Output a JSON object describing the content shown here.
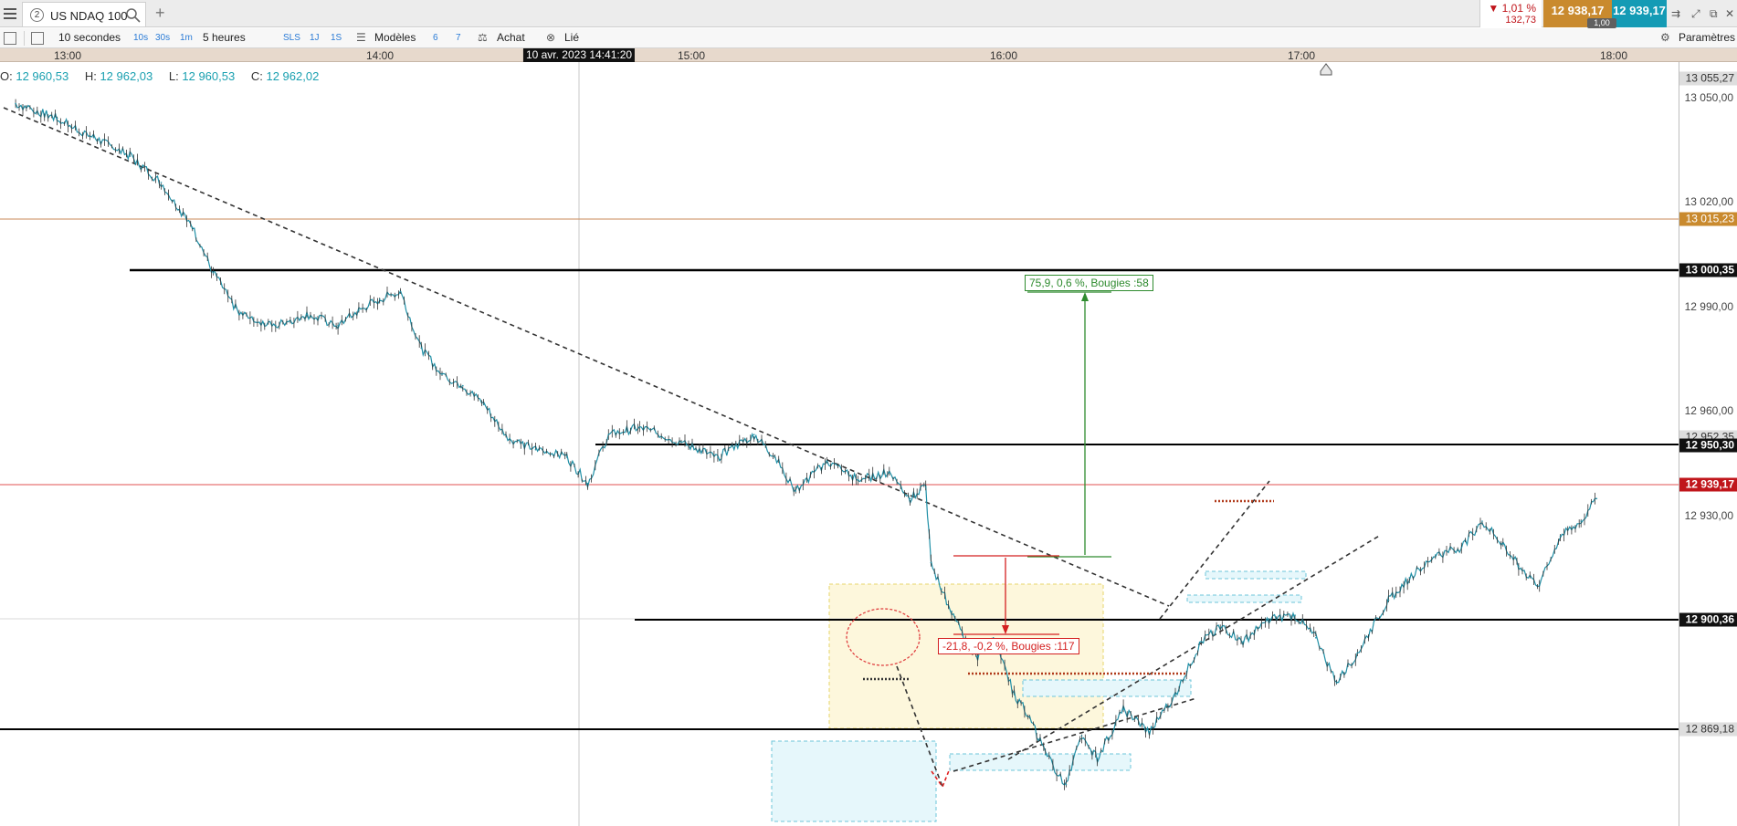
{
  "topbar": {
    "tab_number": "2",
    "tab_title": "US NDAQ 100",
    "change_pct": "▼ 1,01 %",
    "change_abs": "132,73",
    "sell_price": "12 938,17",
    "buy_price": "12 939,17",
    "quantity": "1,00"
  },
  "toolbar": {
    "interval": "10 secondes",
    "interval_shortcuts": [
      "10s",
      "30s",
      "1m"
    ],
    "duration": "5 heures",
    "duration_shortcuts": [
      "SLS",
      "1J",
      "1S"
    ],
    "models_label": "Modèles",
    "models_shortcuts": [
      "6",
      "7"
    ],
    "buy_label": "Achat",
    "linked_label": "Lié",
    "settings_label": "Paramètres"
  },
  "chart_data": {
    "type": "line",
    "title": "US NDAQ 100",
    "x_ticks": [
      "13:00",
      "14:00",
      "15:00",
      "16:00",
      "17:00",
      "18:00"
    ],
    "cursor_time": "10 avr. 2023 14:41:20",
    "ohlc": {
      "open": "12 960,53",
      "high": "12 962,03",
      "low": "12 960,53",
      "close": "12 962,02"
    },
    "y_axis": {
      "ticks": [
        "13 050,00",
        "13 020,00",
        "12 990,00",
        "12 960,00",
        "12 930,00"
      ],
      "range": [
        12855,
        13058
      ],
      "tags": [
        {
          "label": "13 055,27",
          "style": "grey",
          "price": 13055.27
        },
        {
          "label": "13 015,23",
          "style": "orange",
          "price": 13015.23
        },
        {
          "label": "13 000,35",
          "style": "black",
          "price": 13000.35
        },
        {
          "label": "12 952,35",
          "style": "grey",
          "price": 12952.35
        },
        {
          "label": "12 950,30",
          "style": "black",
          "price": 12950.3
        },
        {
          "label": "12 939,17",
          "style": "red",
          "price": 12939.17
        },
        {
          "label": "12 900,36",
          "style": "black",
          "price": 12900.36
        },
        {
          "label": "12 869,18",
          "style": "grey",
          "price": 12869.18
        }
      ]
    },
    "series": [
      {
        "values": [
          [
            "12:50",
            13047
          ],
          [
            "12:58",
            13043
          ],
          [
            "13:05",
            13038
          ],
          [
            "13:12",
            13033
          ],
          [
            "13:18",
            13026
          ],
          [
            "13:24",
            13014
          ],
          [
            "13:28",
            13002
          ],
          [
            "13:33",
            12991
          ],
          [
            "13:40",
            12988
          ],
          [
            "13:46",
            12991
          ],
          [
            "13:52",
            12988
          ],
          [
            "13:56",
            12992
          ],
          [
            "14:00",
            12995
          ],
          [
            "14:04",
            12997
          ],
          [
            "14:08",
            12982
          ],
          [
            "14:12",
            12975
          ],
          [
            "14:16",
            12972
          ],
          [
            "14:20",
            12967
          ],
          [
            "14:25",
            12958
          ],
          [
            "14:30",
            12955
          ],
          [
            "14:36",
            12953
          ],
          [
            "14:40",
            12946
          ],
          [
            "14:44",
            12959
          ],
          [
            "14:50",
            12961
          ],
          [
            "14:58",
            12957
          ],
          [
            "15:05",
            12953
          ],
          [
            "15:12",
            12959
          ],
          [
            "15:16",
            12953
          ],
          [
            "15:20",
            12944
          ],
          [
            "15:26",
            12952
          ],
          [
            "15:32",
            12947
          ],
          [
            "15:38",
            12949
          ],
          [
            "15:42",
            12942
          ],
          [
            "15:45",
            12945
          ],
          [
            "15:46",
            12925
          ],
          [
            "15:48",
            12918
          ],
          [
            "15:50",
            12912
          ],
          [
            "15:52",
            12906
          ],
          [
            "15:55",
            12900
          ],
          [
            "15:58",
            12905
          ],
          [
            "16:02",
            12890
          ],
          [
            "16:05",
            12884
          ],
          [
            "16:08",
            12874
          ],
          [
            "16:12",
            12866
          ],
          [
            "16:15",
            12879
          ],
          [
            "16:18",
            12873
          ],
          [
            "16:23",
            12886
          ],
          [
            "16:28",
            12880
          ],
          [
            "16:33",
            12890
          ],
          [
            "16:38",
            12904
          ],
          [
            "16:42",
            12908
          ],
          [
            "16:46",
            12904
          ],
          [
            "16:51",
            12910
          ],
          [
            "16:56",
            12911
          ],
          [
            "17:00",
            12905
          ],
          [
            "17:04",
            12893
          ],
          [
            "17:08",
            12901
          ],
          [
            "17:14",
            12915
          ],
          [
            "17:18",
            12921
          ],
          [
            "17:23",
            12927
          ],
          [
            "17:28",
            12929
          ],
          [
            "17:32",
            12936
          ],
          [
            "17:36",
            12930
          ],
          [
            "17:39",
            12924
          ],
          [
            "17:43",
            12919
          ],
          [
            "17:47",
            12932
          ],
          [
            "17:51",
            12936
          ],
          [
            "17:54",
            12942
          ]
        ]
      }
    ],
    "annotations": [
      {
        "label": "75,9, 0,6 %, Bougies :58",
        "color": "#2e8b2e"
      },
      {
        "label": "-21,8, -0,2 %, Bougies :117",
        "color": "#d42020"
      }
    ],
    "grid": false
  }
}
